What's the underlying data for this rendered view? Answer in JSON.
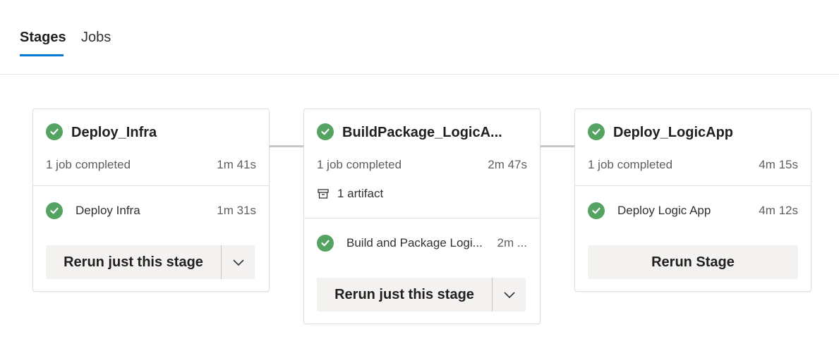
{
  "tabs": [
    {
      "label": "Stages",
      "active": true
    },
    {
      "label": "Jobs",
      "active": false
    }
  ],
  "colors": {
    "accent": "#0078d4",
    "success": "#55a362"
  },
  "stages": [
    {
      "title": "Deploy_Infra",
      "status_icon": "success-check-icon",
      "jobs_status": "1 job completed",
      "duration": "1m 41s",
      "jobs": [
        {
          "name": "Deploy Infra",
          "duration": "1m 31s",
          "status_icon": "success-check-icon"
        }
      ],
      "action": {
        "label": "Rerun just this stage",
        "has_dropdown": true
      }
    },
    {
      "title": "BuildPackage_LogicA...",
      "status_icon": "success-check-icon",
      "jobs_status": "1 job completed",
      "duration": "2m 47s",
      "artifact": {
        "label": "1 artifact",
        "icon": "artifact-icon"
      },
      "jobs": [
        {
          "name": "Build and Package Logi...",
          "duration": "2m ...",
          "status_icon": "success-check-icon"
        }
      ],
      "action": {
        "label": "Rerun just this stage",
        "has_dropdown": true
      }
    },
    {
      "title": "Deploy_LogicApp",
      "status_icon": "success-check-icon",
      "jobs_status": "1 job completed",
      "duration": "4m 15s",
      "jobs": [
        {
          "name": "Deploy Logic App",
          "duration": "4m 12s",
          "status_icon": "success-check-icon"
        }
      ],
      "action": {
        "label": "Rerun Stage",
        "has_dropdown": false
      }
    }
  ]
}
